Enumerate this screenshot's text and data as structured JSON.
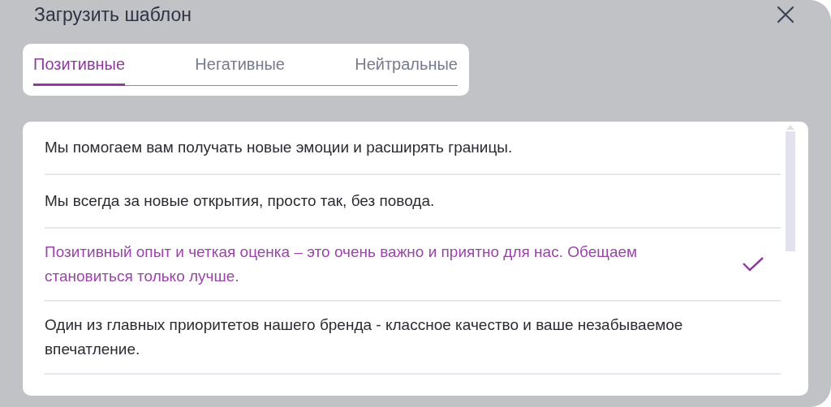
{
  "dialog": {
    "title": "Загрузить шаблон"
  },
  "tabs": [
    {
      "label": "Позитивные",
      "selected": true
    },
    {
      "label": "Негативные",
      "selected": false
    },
    {
      "label": "Нейтральные",
      "selected": false
    }
  ],
  "templates": [
    {
      "text": "Мы помогаем вам получать новые эмоции и расширять границы.",
      "selected": false
    },
    {
      "text": "Мы всегда за новые открытия, просто так, без повода.",
      "selected": false
    },
    {
      "text": "Позитивный опыт и четкая оценка – это очень важно и приятно для нас. Обещаем становиться только лучше.",
      "selected": true
    },
    {
      "text": "Один из главных приоритетов нашего бренда - классное качество и ваше незабываемое впечатление.",
      "selected": false
    }
  ]
}
